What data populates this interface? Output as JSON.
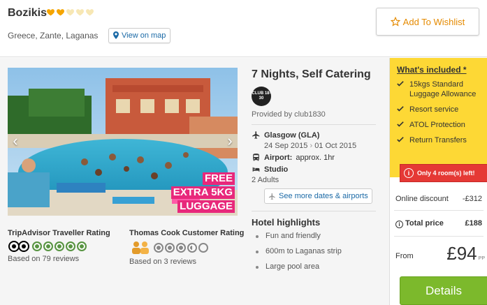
{
  "hotel": {
    "name": "Bozikis",
    "rating_hearts_filled": 2,
    "rating_hearts_total": 5,
    "location": "Greece, Zante, Laganas",
    "view_map_label": "View on map"
  },
  "wishlist_label": "Add To Wishlist",
  "photo": {
    "promo_lines": [
      "FREE",
      "EXTRA 5KG",
      "LUGGAGE"
    ]
  },
  "ratings": {
    "tripadvisor": {
      "title": "TripAdvisor Traveller Rating",
      "score": 5,
      "max": 5,
      "reviews": "Based on 79 reviews"
    },
    "thomascook": {
      "title": "Thomas Cook Customer Rating",
      "score": 3.5,
      "max": 5,
      "reviews": "Based on 3 reviews"
    }
  },
  "details": {
    "title": "7 Nights, Self Catering",
    "logo_text": "CLUB 18-30",
    "provided_by": "Provided by club1830",
    "flight_from": "Glasgow (GLA)",
    "date_out": "24 Sep 2015",
    "date_return": "01 Oct 2015",
    "airport_label": "Airport:",
    "airport_value": "approx. 1hr",
    "room_type": "Studio",
    "occupancy": "2 Adults",
    "more_dates_label": "See more dates & airports",
    "highlights_title": "Hotel highlights",
    "highlights": [
      "Fun and friendly",
      "600m to Laganas strip",
      "Large pool area"
    ]
  },
  "price": {
    "included_title": "What's included *",
    "included": [
      "15kgs Standard Luggage Allowance",
      "Resort service",
      "ATOL Protection",
      "Return Transfers"
    ],
    "alert": "Only 4 room(s) left!",
    "discount_label": "Online discount",
    "discount_value": "-£312",
    "total_label": "Total price",
    "total_value": "£188",
    "from_label": "From",
    "from_value": "£94",
    "pp": "PP",
    "details_button": "Details"
  },
  "colors": {
    "accent_orange": "#e58a00",
    "included_yellow": "#fdd835",
    "details_green": "#7cb92c",
    "alert_red": "#e53935",
    "tripadvisor_green": "#589442"
  }
}
